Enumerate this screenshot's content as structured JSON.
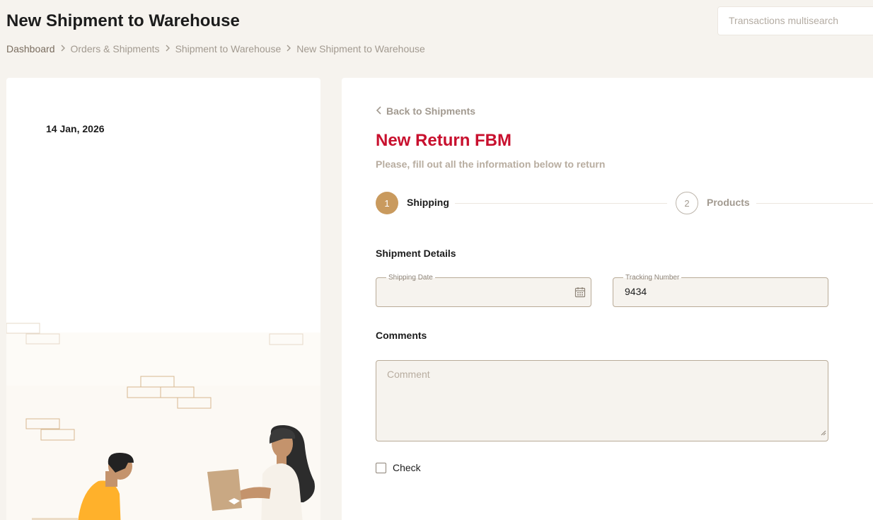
{
  "header": {
    "title": "New Shipment to Warehouse",
    "search_placeholder": "Transactions multisearch"
  },
  "breadcrumb": [
    "Dashboard",
    "Orders & Shipments",
    "Shipment to Warehouse",
    "New Shipment to Warehouse"
  ],
  "left_panel": {
    "date": "14 Jan, 2026"
  },
  "form": {
    "back_label": "Back to Shipments",
    "title": "New Return FBM",
    "subtitle": "Please, fill out all the information below to return",
    "steps": [
      {
        "number": "1",
        "label": "Shipping",
        "active": true
      },
      {
        "number": "2",
        "label": "Products",
        "active": false
      }
    ],
    "shipment_details_heading": "Shipment Details",
    "shipping_date": {
      "label": "Shipping Date",
      "value": ""
    },
    "tracking_number": {
      "label": "Tracking Number",
      "value": "9434"
    },
    "comments_heading": "Comments",
    "comment_placeholder": "Comment",
    "check_label": "Check",
    "check_checked": false
  },
  "icons": {
    "breadcrumb_separator": "chevron-right-icon",
    "back": "chevron-left-icon",
    "date_picker": "calendar-icon"
  },
  "colors": {
    "background": "#f6f3ee",
    "title_accent": "#c8102e",
    "step_active": "#c99a5e",
    "muted_text": "#a29a90",
    "field_bg": "#f6f3ee",
    "field_border": "#b9ab98"
  }
}
